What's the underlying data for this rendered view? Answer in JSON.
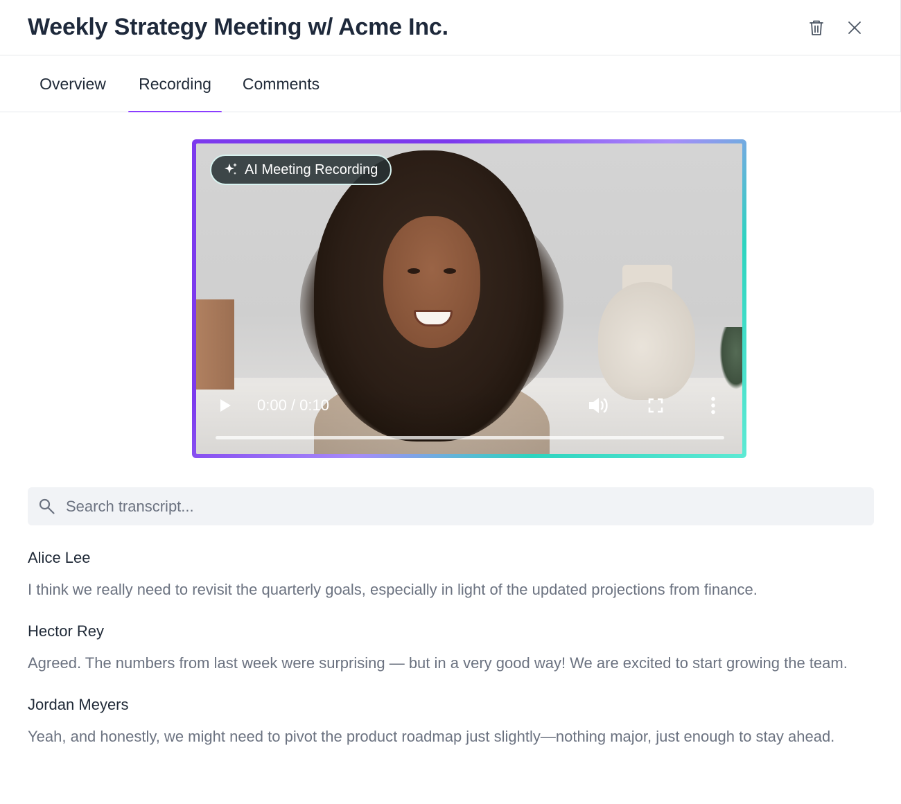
{
  "header": {
    "title": "Weekly Strategy Meeting w/ Acme Inc."
  },
  "tabs": [
    {
      "label": "Overview",
      "active": false
    },
    {
      "label": "Recording",
      "active": true
    },
    {
      "label": "Comments",
      "active": false
    }
  ],
  "video": {
    "badge_label": "AI Meeting Recording",
    "time": "0:00 / 0:10",
    "progress": 0
  },
  "search": {
    "placeholder": "Search transcript..."
  },
  "transcript": [
    {
      "speaker": "Alice Lee",
      "text": "I think we really need to revisit the quarterly goals, especially in light of the updated projections from finance."
    },
    {
      "speaker": "Hector Rey",
      "text": "Agreed. The numbers from last week were surprising — but in a very good way! We are excited to start growing the team."
    },
    {
      "speaker": "Jordan Meyers",
      "text": "Yeah, and honestly, we might need to pivot the product roadmap just slightly—nothing major, just enough to stay ahead."
    }
  ],
  "colors": {
    "accent": "#8b3dff",
    "frame_gradient_start": "#7c3aed",
    "frame_gradient_end": "#2dd4bf"
  },
  "icons": [
    "trash-icon",
    "close-icon",
    "sparkle-icon",
    "play-icon",
    "volume-icon",
    "fullscreen-icon",
    "more-vertical-icon",
    "search-icon"
  ]
}
